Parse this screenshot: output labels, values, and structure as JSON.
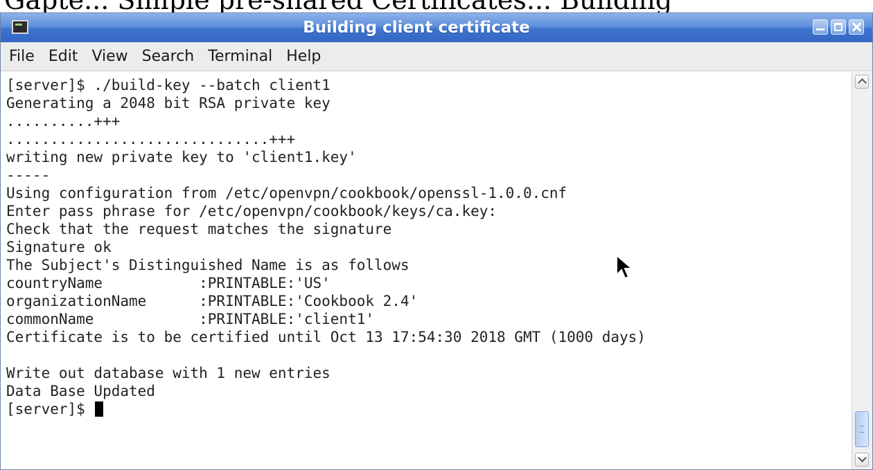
{
  "top_text": "Gapte... Simple pre-shared Certificates... Building",
  "window": {
    "title": "Building client certificate"
  },
  "menu": [
    "File",
    "Edit",
    "View",
    "Search",
    "Terminal",
    "Help"
  ],
  "terminal": {
    "lines": [
      "[server]$ ./build-key --batch client1",
      "Generating a 2048 bit RSA private key",
      "..........+++",
      "..............................+++",
      "writing new private key to 'client1.key'",
      "-----",
      "Using configuration from /etc/openvpn/cookbook/openssl-1.0.0.cnf",
      "Enter pass phrase for /etc/openvpn/cookbook/keys/ca.key:",
      "Check that the request matches the signature",
      "Signature ok",
      "The Subject's Distinguished Name is as follows",
      "countryName           :PRINTABLE:'US'",
      "organizationName      :PRINTABLE:'Cookbook 2.4'",
      "commonName            :PRINTABLE:'client1'",
      "Certificate is to be certified until Oct 13 17:54:30 2018 GMT (1000 days)",
      "",
      "Write out database with 1 new entries",
      "Data Base Updated"
    ],
    "prompt": "[server]$ "
  },
  "colors": {
    "titlebar": "#3c73cf",
    "terminal_bg": "#ffffff",
    "text": "#222222"
  },
  "icons": {
    "app": "terminal-icon",
    "minimize": "minimize-icon",
    "maximize": "maximize-icon",
    "close": "close-icon",
    "pointer": "mouse-pointer-icon"
  }
}
